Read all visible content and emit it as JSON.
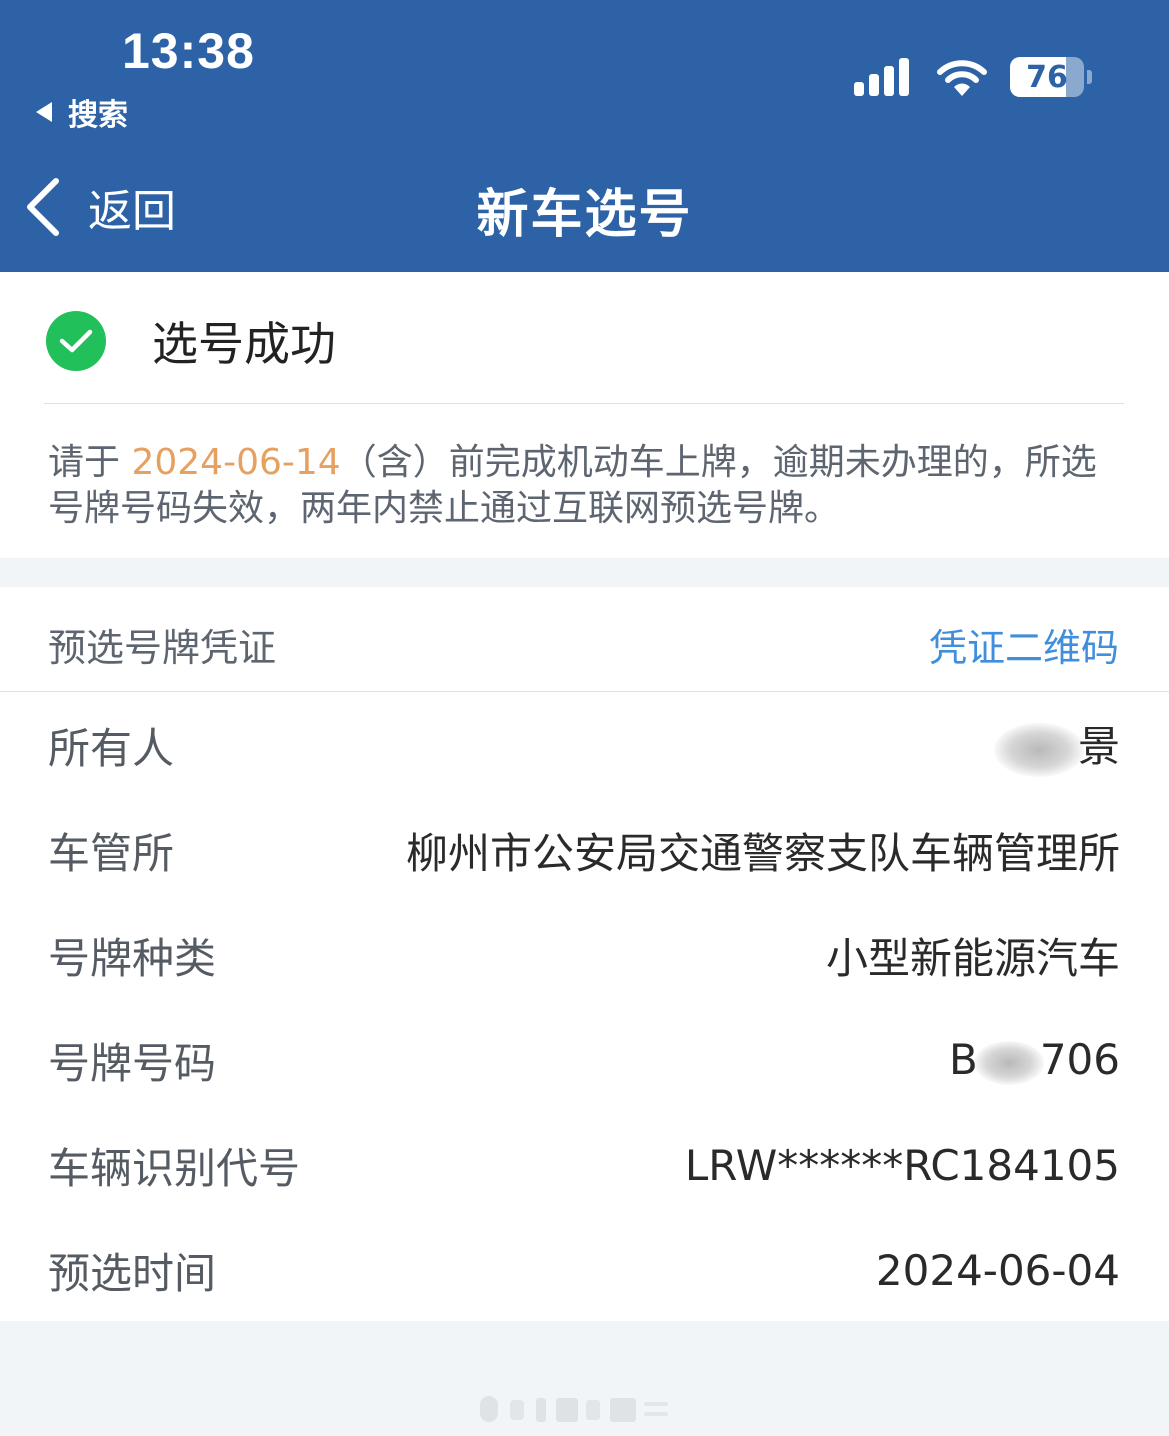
{
  "status_bar": {
    "time": "13:38",
    "back_app_label": "搜索",
    "battery_level": "76"
  },
  "nav": {
    "back_label": "返回",
    "title": "新车选号"
  },
  "result": {
    "status_text": "选号成功",
    "notice_prefix": "请于",
    "deadline": "2024-06-14",
    "notice_suffix": "（含）前完成机动车上牌，逾期未办理的，所选号牌号码失效，两年内禁止通过互联网预选号牌。"
  },
  "voucher": {
    "title": "预选号牌凭证",
    "qr_link_label": "凭证二维码",
    "rows": [
      {
        "label": "所有人",
        "value": "景"
      },
      {
        "label": "车管所",
        "value": "柳州市公安局交通警察支队车辆管理所"
      },
      {
        "label": "号牌种类",
        "value": "小型新能源汽车"
      },
      {
        "label": "号牌号码",
        "value_prefix": "B",
        "value_suffix": "706"
      },
      {
        "label": "车辆识别代号",
        "value": "LRW******RC184105"
      },
      {
        "label": "预选时间",
        "value": "2024-06-04"
      }
    ]
  },
  "colors": {
    "header_bg": "#2d63a6",
    "success_green": "#22c05a",
    "deadline_orange": "#e6a060",
    "link_blue": "#3f8fdc"
  }
}
